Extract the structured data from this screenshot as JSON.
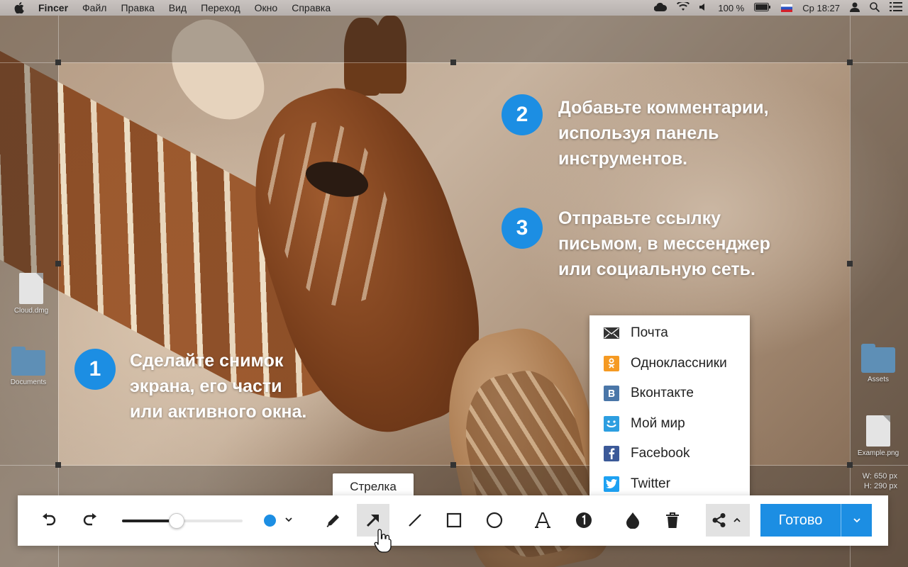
{
  "menubar": {
    "app_name": "Fincer",
    "items": [
      "Файл",
      "Правка",
      "Вид",
      "Переход",
      "Окно",
      "Справка"
    ],
    "battery": "100 %",
    "clock": "Ср 18:27"
  },
  "desktop": {
    "icons": [
      {
        "label": "Cloud.dmg",
        "icon": "disk-image-icon"
      },
      {
        "label": "Documents",
        "icon": "folder-icon"
      },
      {
        "label": "Assets",
        "icon": "folder-icon"
      },
      {
        "label": "Example.png",
        "icon": "png-file-icon"
      }
    ]
  },
  "steps": [
    {
      "number": "1",
      "lines": [
        "Сделайте снимок",
        "экрана, его части",
        "или активного окна."
      ]
    },
    {
      "number": "2",
      "lines": [
        "Добавьте комментарии,",
        "используя панель",
        "инструментов."
      ]
    },
    {
      "number": "3",
      "lines": [
        "Отправьте ссылку",
        "письмом, в мессенджер",
        "или социальную сеть."
      ]
    }
  ],
  "share_menu": {
    "items": [
      {
        "label": "Почта",
        "icon": "mail-icon",
        "color": "#333333"
      },
      {
        "label": "Одноклассники",
        "icon": "odnoklassniki-icon",
        "color": "#f59a23"
      },
      {
        "label": "Вконтакте",
        "icon": "vk-icon",
        "color": "#4a76a8"
      },
      {
        "label": "Мой мир",
        "icon": "moymir-icon",
        "color": "#2d9ee0"
      },
      {
        "label": "Facebook",
        "icon": "facebook-icon",
        "color": "#3b5998"
      },
      {
        "label": "Twitter",
        "icon": "twitter-icon",
        "color": "#1da1f2"
      }
    ]
  },
  "tooltip": "Стрелка",
  "selection": {
    "width": "W: 650 px",
    "height": "H: 290 px"
  },
  "toolbar": {
    "line_width": 0.45,
    "color": "#1c8ee3",
    "active_tool": "arrow",
    "done_label": "Готово"
  }
}
